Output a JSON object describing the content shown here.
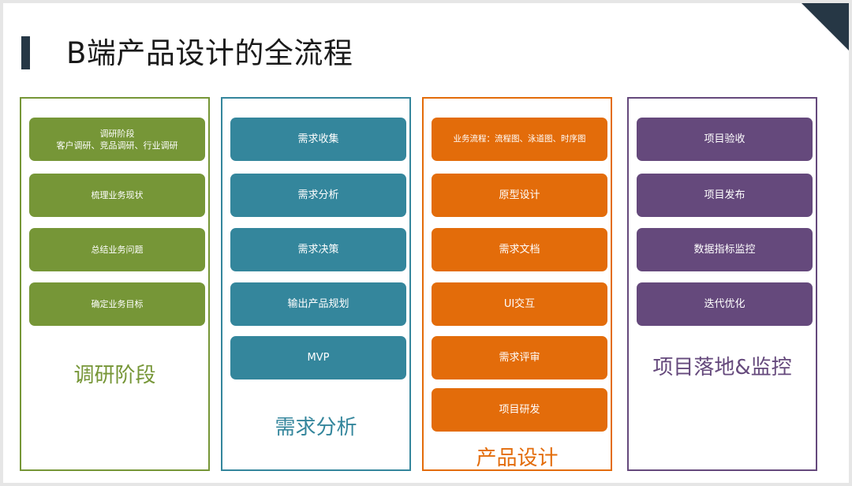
{
  "slide": {
    "title": "B端产品设计的全流程"
  },
  "columns": {
    "research": {
      "label": "调研阶段",
      "items": [
        {
          "line1": "调研阶段",
          "line2": "客户调研、竞品调研、行业调研"
        },
        {
          "line1": "梳理业务现状"
        },
        {
          "line1": "总结业务问题"
        },
        {
          "line1": "确定业务目标"
        }
      ]
    },
    "requirements": {
      "label": "需求分析",
      "items": [
        "需求收集",
        "需求分析",
        "需求决策",
        "输出产品规划",
        "MVP"
      ]
    },
    "design": {
      "label": "产品设计",
      "items": [
        "业务流程：流程图、泳道图、时序图",
        "原型设计",
        "需求文档",
        "UI交互",
        "需求评审",
        "项目研发"
      ]
    },
    "launch": {
      "label": "项目落地&监控",
      "items": [
        "项目验收",
        "项目发布",
        "数据指标监控",
        "迭代优化"
      ]
    }
  },
  "colors": {
    "green": "#769637",
    "teal": "#34869c",
    "orange": "#e36c0a",
    "purple": "#65497c",
    "dark": "#263745"
  }
}
